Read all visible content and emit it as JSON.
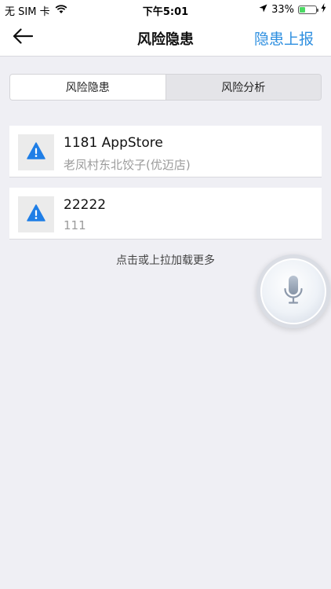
{
  "status_bar": {
    "carrier": "无 SIM 卡",
    "time": "下午5:01",
    "battery_percent": "33%",
    "battery_level": 0.33,
    "icons": [
      "wifi-icon",
      "location-arrow-icon",
      "battery-icon",
      "charging-bolt-icon"
    ]
  },
  "nav": {
    "title": "风险隐患",
    "action_label": "隐患上报",
    "back_icon": "arrow-left-icon"
  },
  "segments": [
    {
      "label": "风险隐患",
      "active": true
    },
    {
      "label": "风险分析",
      "active": false
    }
  ],
  "items": [
    {
      "title": "1181 AppStore",
      "subtitle": "老凤村东北饺子(优迈店)",
      "icon": "warning-triangle-icon"
    },
    {
      "title": "22222",
      "subtitle": "111",
      "icon": "warning-triangle-icon"
    }
  ],
  "load_more": "点击或上拉加载更多",
  "colors": {
    "accent": "#2e8fe0",
    "warning_icon": "#1f7ee6",
    "background": "#efeff4"
  }
}
